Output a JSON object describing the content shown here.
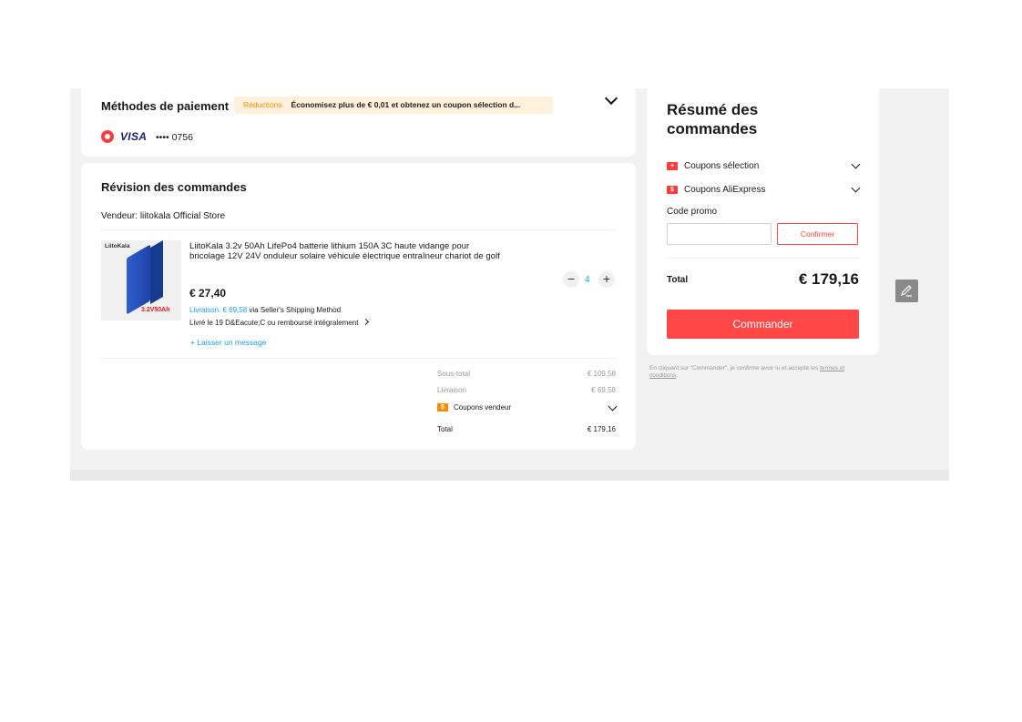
{
  "payment": {
    "title": "Méthodes de paiement",
    "discount_label": "Réductions",
    "discount_text": "Économisez plus de € 0,01 et obtenez un coupon sélection d...",
    "card_brand": "VISA",
    "card_number": "•••• 0756"
  },
  "review": {
    "title": "Révision des commandes",
    "seller": "Vendeur: liitokala Official Store",
    "product": {
      "brand_tag": "LiitoKala",
      "capacity_label": "3.2V50Ah",
      "title": "LiitoKala 3.2v 50Ah LifePo4 batterie lithium 150A 3C haute vidange pour bricolage 12V 24V onduleur solaire véhicule électrique entraîneur chariot de golf",
      "price": "€ 27,40",
      "shipping_cost": "Livraison: € 69,58",
      "shipping_method": "via Seller's Shipping Method",
      "delivery": "Livré le 19 D&Eacute;C ou remboursé intégralement",
      "message_link": "+ Laisser un message",
      "quantity": "4"
    },
    "totals": {
      "subtotal_label": "Sous-total",
      "subtotal_value": "€ 109,58",
      "shipping_label": "Livraison",
      "shipping_value": "€ 69,58",
      "seller_coupons_label": "Coupons vendeur",
      "total_label": "Total",
      "total_value": "€ 179,16"
    }
  },
  "summary": {
    "title": "Résumé des commandes",
    "coupons_selection": "Coupons sélection",
    "coupons_aliexpress": "Coupons AliExpress",
    "promo_label": "Code promo",
    "confirm_button": "Confirmer",
    "total_label": "Total",
    "total_value": "€ 179,16",
    "order_button": "Commander",
    "legal_text": "En cliquant sur \"Commander\", je confirme avoir lu et accepté les ",
    "terms_link": "termes et conditions",
    "legal_end": "."
  },
  "colors": {
    "accent": "#ff4747",
    "link": "#1f9be0",
    "coupon": "#ff8a00"
  }
}
